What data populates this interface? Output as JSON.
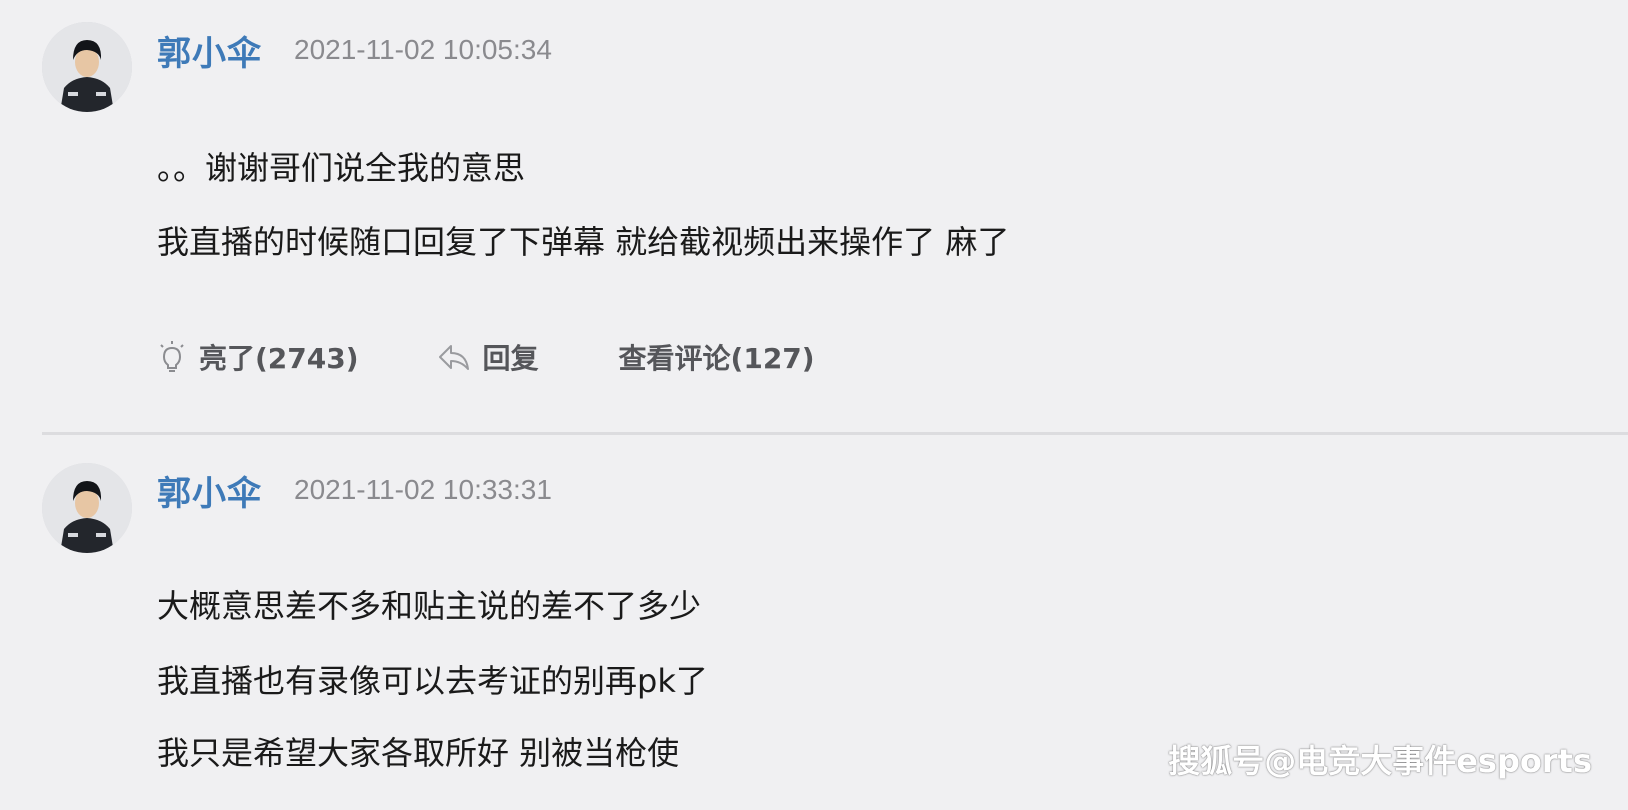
{
  "comments": [
    {
      "username": "郭小伞",
      "timestamp": "2021-11-02 10:05:34",
      "lines": [
        "。。谢谢哥们说全我的意思",
        "我直播的时候随口回复了下弹幕 就给截视频出来操作了 麻了"
      ],
      "actions": {
        "like_label": "亮了(2743)",
        "reply_label": "回复",
        "view_replies_label": "查看评论(127)"
      }
    },
    {
      "username": "郭小伞",
      "timestamp": "2021-11-02 10:33:31",
      "lines": [
        "大概意思差不多和贴主说的差不了多少",
        "我直播也有录像可以去考证的别再pk了",
        "我只是希望大家各取所好 别被当枪使"
      ]
    }
  ],
  "watermark": "搜狐号@电竞大事件esports",
  "colors": {
    "background": "#f0f0f2",
    "username": "#3e7ab8",
    "timestamp": "#8a8a8e",
    "action_text": "#55565a",
    "divider": "#dcdcdf"
  },
  "icons": {
    "like": "lightbulb-icon",
    "reply": "reply-arrow-icon"
  }
}
